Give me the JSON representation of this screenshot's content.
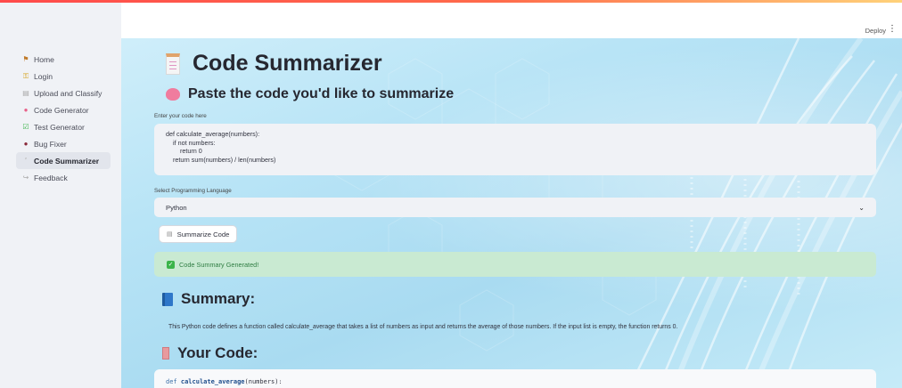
{
  "app": {
    "accent_color": "#ff4b4b"
  },
  "header": {
    "deploy_label": "Deploy",
    "menu_icon": "vertical-dots-icon"
  },
  "sidebar": {
    "items": [
      {
        "label": "Home",
        "icon": "house-icon",
        "active": false
      },
      {
        "label": "Login",
        "icon": "key-icon",
        "active": false
      },
      {
        "label": "Upload and Classify",
        "icon": "document-icon",
        "active": false
      },
      {
        "label": "Code Generator",
        "icon": "brain-icon",
        "active": false
      },
      {
        "label": "Test Generator",
        "icon": "check-box-icon",
        "active": false
      },
      {
        "label": "Bug Fixer",
        "icon": "bug-icon",
        "active": false
      },
      {
        "label": "Code Summarizer",
        "icon": "scroll-icon",
        "active": true
      },
      {
        "label": "Feedback",
        "icon": "speech-bubble-icon",
        "active": false
      }
    ]
  },
  "main": {
    "title": "Code Summarizer",
    "subheading": "Paste the code you'd like to summarize",
    "code_input_label": "Enter your code here",
    "code_input_value": "def calculate_average(numbers):\n    if not numbers:\n        return 0\n    return sum(numbers) / len(numbers)",
    "language_label": "Select Programming Language",
    "language_value": "Python",
    "summarize_button": "Summarize Code",
    "success_message": "Code Summary Generated!",
    "summary_heading": "Summary:",
    "summary_text": "This Python code defines a function called calculate_average that takes a list of numbers as input and returns the average of those numbers. If the input list is empty, the function returns 0.",
    "your_code_heading": "Your Code:",
    "code_keyword": "def",
    "code_function": "calculate_average",
    "code_rest": "(numbers):"
  }
}
